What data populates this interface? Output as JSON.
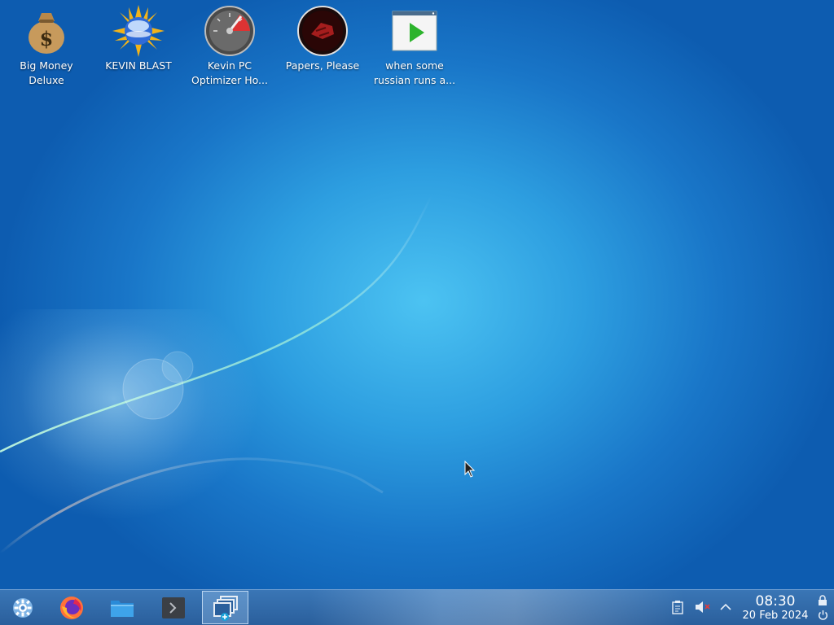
{
  "desktop": {
    "icons": [
      {
        "label": "Big Money Deluxe",
        "icon": "money-bag-icon"
      },
      {
        "label": "KEVIN BLAST",
        "icon": "sun-orb-icon"
      },
      {
        "label": "Kevin PC Optimizer Ho...",
        "icon": "speedometer-icon"
      },
      {
        "label": "Papers, Please",
        "icon": "papers-please-icon"
      },
      {
        "label": "when some russian runs a...",
        "icon": "video-play-icon"
      }
    ]
  },
  "taskbar": {
    "launcher": {
      "icon": "kde-application-launcher-icon"
    },
    "pinned": [
      {
        "name": "Firefox",
        "icon": "firefox-icon"
      },
      {
        "name": "File Manager",
        "icon": "folder-icon"
      },
      {
        "name": "Terminal",
        "icon": "terminal-icon"
      }
    ],
    "active_task": {
      "icon": "window-switcher-icon"
    },
    "tray": {
      "clipboard_icon": "clipboard-icon",
      "volume_icon": "volume-muted-icon",
      "expand_icon": "chevron-up-icon"
    },
    "clock": {
      "time": "08:30",
      "date": "20 Feb 2024"
    },
    "lock_icon": "lock-icon",
    "power_icon": "power-icon"
  },
  "colors": {
    "taskbar_bg": "#2a5f9c",
    "desktop_accent": "#4cc3f2"
  }
}
